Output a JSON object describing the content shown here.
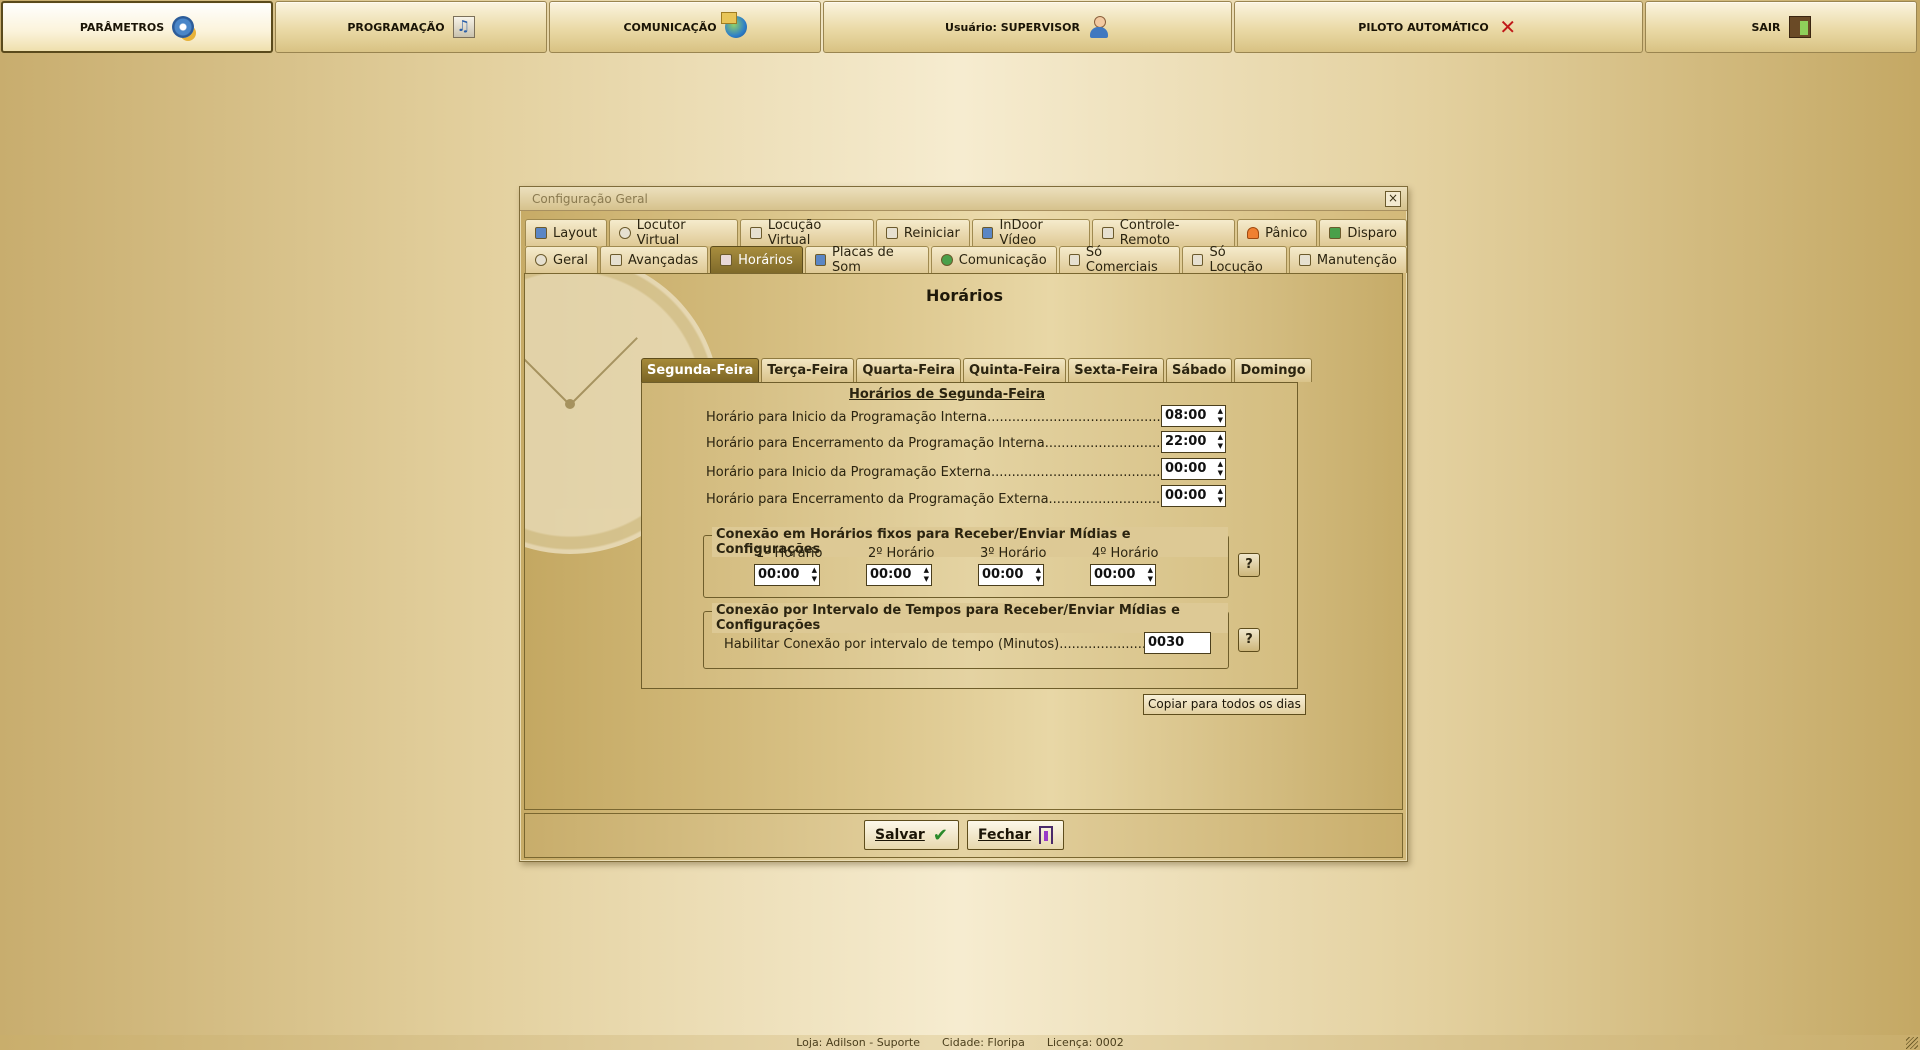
{
  "topnav": [
    {
      "label": "PARÂMETROS",
      "icon": "gear-icon"
    },
    {
      "label": "PROGRAMAÇÃO",
      "icon": "music-icon"
    },
    {
      "label": "COMUNICAÇÃO",
      "icon": "globe-icon"
    },
    {
      "label": "Usuário: SUPERVISOR",
      "icon": "user-icon"
    },
    {
      "label": "PILOTO AUTOMÁTICO",
      "icon": "x-icon"
    },
    {
      "label": "SAIR",
      "icon": "exit-door-icon"
    }
  ],
  "window": {
    "title": "Configuração Geral",
    "close_glyph": "×",
    "tabs_row1": [
      "Layout",
      "Locutor Virtual",
      "Locução Virtual",
      "Reiniciar",
      "InDoor Vídeo",
      "Controle-Remoto",
      "Pânico",
      "Disparo"
    ],
    "tabs_row2": [
      "Geral",
      "Avançadas",
      "Horários",
      "Placas de Som",
      "Comunicação",
      "Só Comerciais",
      "Só Locução",
      "Manutenção"
    ],
    "active_tab": "Horários"
  },
  "horarios": {
    "title": "Horários",
    "day_tabs": [
      "Segunda-Feira",
      "Terça-Feira",
      "Quarta-Feira",
      "Quinta-Feira",
      "Sexta-Feira",
      "Sábado",
      "Domingo"
    ],
    "active_day": "Segunda-Feira",
    "day_heading": "Horários de Segunda-Feira",
    "rows": [
      {
        "label": "Horário para Inicio da Programação Interna..........................................:",
        "value": "08:00"
      },
      {
        "label": "Horário para Encerramento da Programação Interna............................:",
        "value": "22:00"
      },
      {
        "label": "Horário para Inicio da Programação Externa.........................................:",
        "value": "00:00"
      },
      {
        "label": "Horário para Encerramento da Programação Externa...........................:",
        "value": "00:00"
      }
    ],
    "fixed_group": {
      "legend": "Conexão em Horários fixos para Receber/Enviar Mídias e Configurações",
      "columns": [
        {
          "label": "1º Horário",
          "value": "00:00"
        },
        {
          "label": "2º Horário",
          "value": "00:00"
        },
        {
          "label": "3º Horário",
          "value": "00:00"
        },
        {
          "label": "4º Horário",
          "value": "00:00"
        }
      ],
      "help": "?"
    },
    "interval_group": {
      "legend": "Conexão por Intervalo de Tempos para Receber/Enviar Mídias e Configurações",
      "label": "Habilitar Conexão por intervalo de tempo (Minutos).......................:",
      "value": "0030",
      "help": "?"
    },
    "copy_button": "Copiar para todos os dias"
  },
  "actions": {
    "save": "Salvar",
    "close": "Fechar"
  },
  "status": {
    "loja": "Loja: Adilson - Suporte",
    "cidade": "Cidade: Floripa",
    "licenca": "Licença: 0002"
  }
}
